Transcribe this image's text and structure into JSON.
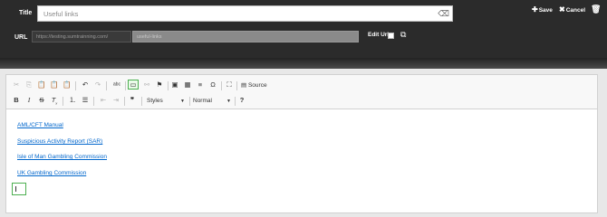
{
  "header": {
    "title_label": "Title",
    "title_value": "Useful links",
    "url_label": "URL",
    "url_prefix": "https://testing.sumtrainning.com/",
    "url_slug": "useful-links",
    "edit_url_label": "Edit Url",
    "save_label": "Save",
    "cancel_label": "Cancel"
  },
  "editor": {
    "toolbar": {
      "source_label": "Source",
      "styles_label": "Styles",
      "format_label": "Normal"
    },
    "links": [
      "AML/CFT Manual",
      "Suspicious Activity Report (SAR)",
      "Isle of Man Gambling Commission",
      "UK Gambling Commission"
    ]
  }
}
